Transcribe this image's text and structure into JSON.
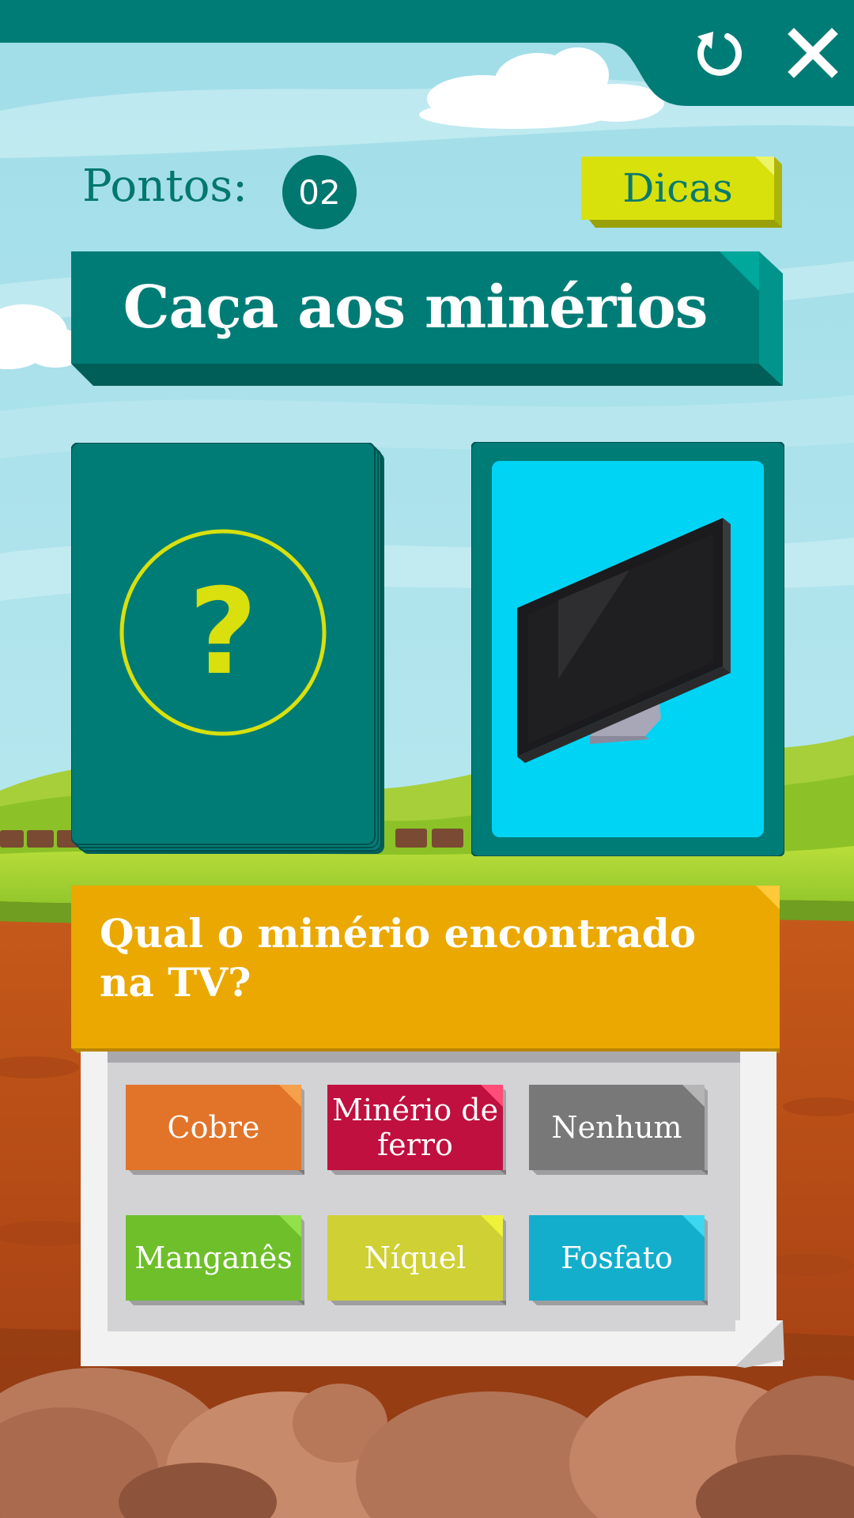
{
  "score": {
    "label": "Pontos:",
    "value": "02"
  },
  "hints": {
    "label": "Dicas"
  },
  "title": "Caça aos minérios",
  "deck": {
    "symbol": "?"
  },
  "item_card": {
    "icon": "tv-monitor-icon"
  },
  "question": "Qual o minério encontrado na TV?",
  "answers": [
    {
      "label": "Cobre",
      "color": "#e2742a",
      "fold": "#f5a04a"
    },
    {
      "label": "Minério de ferro",
      "color": "#c0103f",
      "fold": "#ff4d78"
    },
    {
      "label": "Nenhum",
      "color": "#787878",
      "fold": "#b5b5b5"
    },
    {
      "label": "Manganês",
      "color": "#6ebf2a",
      "fold": "#94e04a"
    },
    {
      "label": "Níquel",
      "color": "#cfd034",
      "fold": "#eef23a"
    },
    {
      "label": "Fosfato",
      "color": "#14aecd",
      "fold": "#3fd6f0"
    }
  ],
  "colors": {
    "teal": "#007c76",
    "sky": "#a7e0ea",
    "hint_yellow": "#d6e00c",
    "question_orange": "#eaa800",
    "item_card_bg": "#00d4f5"
  }
}
